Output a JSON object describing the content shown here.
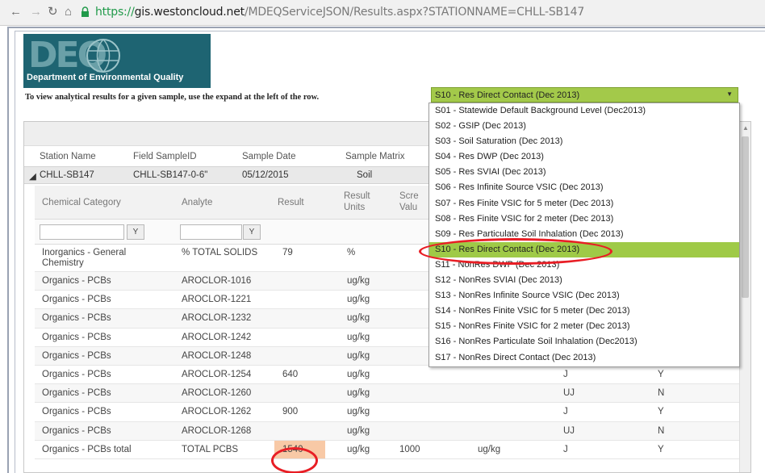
{
  "browser": {
    "back_icon": "arrow-left-icon",
    "reload_icon": "reload-icon",
    "home_icon": "home-icon",
    "url_scheme": "https://",
    "url_host": "gis.westoncloud.net",
    "url_path": "/MDEQServiceJSON/Results.aspx?STATIONNAME=CHLL-SB147"
  },
  "header": {
    "logo_letters": "DEQ",
    "department": "Department of Environmental Quality",
    "instructions": "To view analytical results for a given sample, use the expand at the left of the row."
  },
  "screening_select": {
    "selected": "S10 - Res Direct Contact (Dec 2013)",
    "options": [
      "S01 - Statewide Default Background Level (Dec2013)",
      "S02 - GSIP (Dec 2013)",
      "S03 - Soil Saturation (Dec 2013)",
      "S04 - Res DWP (Dec 2013)",
      "S05 - Res SVIAI (Dec 2013)",
      "S06 - Res Infinite Source VSIC (Dec 2013)",
      "S07 - Res Finite VSIC for 5 meter (Dec 2013)",
      "S08 - Res Finite VSIC for 2 meter (Dec 2013)",
      "S09 - Res Particulate Soil Inhalation (Dec 2013)",
      "S10 - Res Direct Contact (Dec 2013)",
      "S11 - NonRes DWP (Dec 2013)",
      "S12 - NonRes SVIAI (Dec 2013)",
      "S13 - NonRes Infinite Source VSIC (Dec 2013)",
      "S14 - NonRes Finite VSIC for 5 meter (Dec 2013)",
      "S15 - NonRes Finite VSIC for 2 meter (Dec 2013)",
      "S16 - NonRes Particulate Soil Inhalation (Dec2013)",
      "S17 - NonRes Direct Contact (Dec 2013)"
    ]
  },
  "grid": {
    "columns": {
      "station_name": "Station Name",
      "field_sample_id": "Field SampleID",
      "sample_date": "Sample Date",
      "sample_matrix": "Sample Matrix",
      "partial": "h"
    },
    "station": {
      "name": "CHLL-SB147",
      "sample_id": "CHLL-SB147-0-6\"",
      "date": "05/12/2015",
      "matrix": "Soil"
    },
    "sub_columns": {
      "category": "Chemical Category",
      "analyte": "Analyte",
      "result": "Result",
      "result_units_1": "Result",
      "result_units_2": "Units",
      "screening_1": "Scre",
      "screening_2": "Valu"
    },
    "filter_icon": "filter-icon",
    "rows": [
      {
        "category": "Inorganics - General Chemistry",
        "analyte": "% TOTAL SOLIDS",
        "result": "79",
        "units": "%",
        "screen_value": "",
        "screen_units": "",
        "qualifier": "",
        "flag": ""
      },
      {
        "category": "Organics - PCBs",
        "analyte": "AROCLOR-1016",
        "result": "",
        "units": "ug/kg",
        "screen_value": "",
        "screen_units": "",
        "qualifier": "",
        "flag": ""
      },
      {
        "category": "Organics - PCBs",
        "analyte": "AROCLOR-1221",
        "result": "",
        "units": "ug/kg",
        "screen_value": "",
        "screen_units": "",
        "qualifier": "",
        "flag": ""
      },
      {
        "category": "Organics - PCBs",
        "analyte": "AROCLOR-1232",
        "result": "",
        "units": "ug/kg",
        "screen_value": "",
        "screen_units": "",
        "qualifier": "",
        "flag": ""
      },
      {
        "category": "Organics - PCBs",
        "analyte": "AROCLOR-1242",
        "result": "",
        "units": "ug/kg",
        "screen_value": "",
        "screen_units": "",
        "qualifier": "",
        "flag": ""
      },
      {
        "category": "Organics - PCBs",
        "analyte": "AROCLOR-1248",
        "result": "",
        "units": "ug/kg",
        "screen_value": "",
        "screen_units": "",
        "qualifier": "",
        "flag": ""
      },
      {
        "category": "Organics - PCBs",
        "analyte": "AROCLOR-1254",
        "result": "640",
        "units": "ug/kg",
        "screen_value": "",
        "screen_units": "",
        "qualifier": "J",
        "flag": "Y"
      },
      {
        "category": "Organics - PCBs",
        "analyte": "AROCLOR-1260",
        "result": "",
        "units": "ug/kg",
        "screen_value": "",
        "screen_units": "",
        "qualifier": "UJ",
        "flag": "N"
      },
      {
        "category": "Organics - PCBs",
        "analyte": "AROCLOR-1262",
        "result": "900",
        "units": "ug/kg",
        "screen_value": "",
        "screen_units": "",
        "qualifier": "J",
        "flag": "Y"
      },
      {
        "category": "Organics - PCBs",
        "analyte": "AROCLOR-1268",
        "result": "",
        "units": "ug/kg",
        "screen_value": "",
        "screen_units": "",
        "qualifier": "UJ",
        "flag": "N"
      },
      {
        "category": "Organics - PCBs total",
        "analyte": "TOTAL PCBS",
        "result": "1540",
        "units": "ug/kg",
        "screen_value": "1000",
        "screen_units": "ug/kg",
        "qualifier": "J",
        "flag": "Y"
      }
    ],
    "highlight_color": "#f8c9a6"
  },
  "colors": {
    "dropdown_green": "#a3c94a",
    "selected_option_green": "#9fca47",
    "annotation_red": "#e81e25",
    "logo_teal": "#1e6472"
  }
}
